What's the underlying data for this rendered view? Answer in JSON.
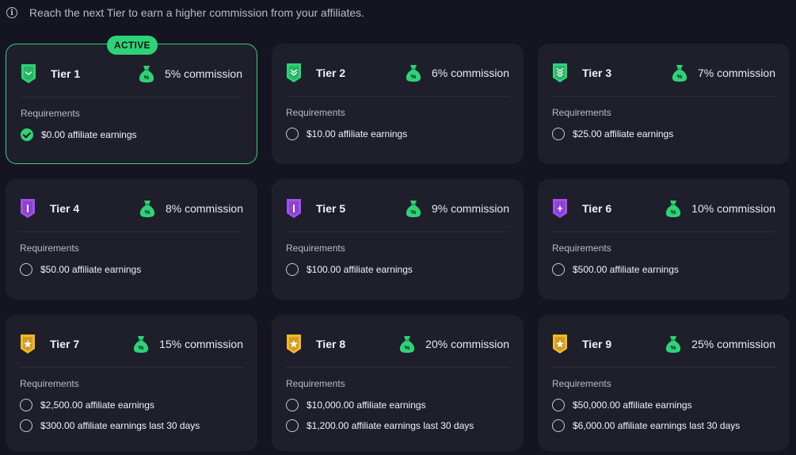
{
  "info": {
    "text": "Reach the next Tier to earn a higher commission from your affiliates."
  },
  "active_label": "ACTIVE",
  "requirements_label": "Requirements",
  "colors": {
    "green": "#2ed377",
    "purple": "#a44ff0",
    "gold": "#f4b928"
  },
  "tiers": [
    {
      "name": "Tier 1",
      "commission": "5% commission",
      "shield": "green",
      "active": true,
      "requirements": [
        {
          "text": "$0.00 affiliate earnings",
          "done": true
        }
      ]
    },
    {
      "name": "Tier 2",
      "commission": "6% commission",
      "shield": "green",
      "active": false,
      "requirements": [
        {
          "text": "$10.00 affiliate earnings",
          "done": false
        }
      ]
    },
    {
      "name": "Tier 3",
      "commission": "7% commission",
      "shield": "green",
      "active": false,
      "requirements": [
        {
          "text": "$25.00 affiliate earnings",
          "done": false
        }
      ]
    },
    {
      "name": "Tier 4",
      "commission": "8% commission",
      "shield": "purple",
      "active": false,
      "requirements": [
        {
          "text": "$50.00 affiliate earnings",
          "done": false
        }
      ]
    },
    {
      "name": "Tier 5",
      "commission": "9% commission",
      "shield": "purple",
      "active": false,
      "requirements": [
        {
          "text": "$100.00 affiliate earnings",
          "done": false
        }
      ]
    },
    {
      "name": "Tier 6",
      "commission": "10% commission",
      "shield": "purple",
      "active": false,
      "requirements": [
        {
          "text": "$500.00 affiliate earnings",
          "done": false
        }
      ]
    },
    {
      "name": "Tier 7",
      "commission": "15% commission",
      "shield": "gold",
      "active": false,
      "requirements": [
        {
          "text": "$2,500.00 affiliate earnings",
          "done": false
        },
        {
          "text": "$300.00 affiliate earnings last 30 days",
          "done": false
        }
      ]
    },
    {
      "name": "Tier 8",
      "commission": "20% commission",
      "shield": "gold",
      "active": false,
      "requirements": [
        {
          "text": "$10,000.00 affiliate earnings",
          "done": false
        },
        {
          "text": "$1,200.00 affiliate earnings last 30 days",
          "done": false
        }
      ]
    },
    {
      "name": "Tier 9",
      "commission": "25% commission",
      "shield": "gold",
      "active": false,
      "requirements": [
        {
          "text": "$50,000.00 affiliate earnings",
          "done": false
        },
        {
          "text": "$6,000.00 affiliate earnings last 30 days",
          "done": false
        }
      ]
    }
  ]
}
